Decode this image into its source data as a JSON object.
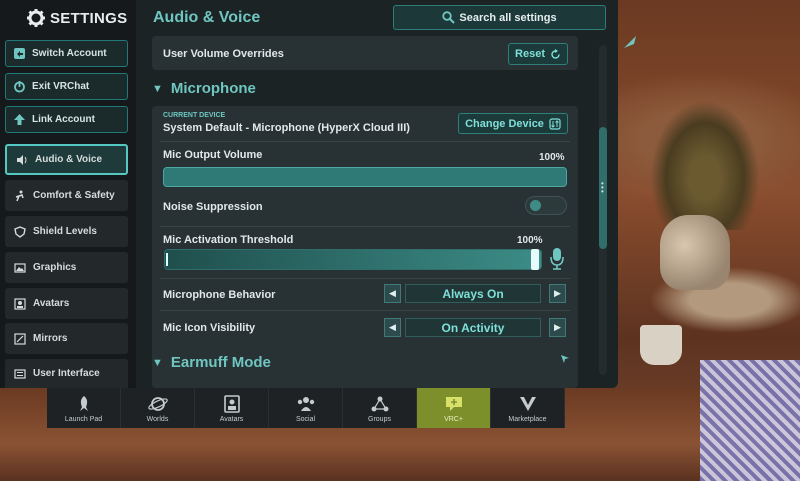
{
  "header": {
    "settings_title": "SETTINGS",
    "panel_title": "Audio & Voice",
    "search_label": "Search all settings"
  },
  "sidebar": {
    "buttons": [
      {
        "label": "Switch Account",
        "icon": "switch-icon"
      },
      {
        "label": "Exit VRChat",
        "icon": "power-icon"
      },
      {
        "label": "Link Account",
        "icon": "arrow-up-icon"
      }
    ],
    "items": [
      {
        "label": "Audio & Voice",
        "icon": "speaker-icon",
        "active": true
      },
      {
        "label": "Comfort & Safety",
        "icon": "person-icon"
      },
      {
        "label": "Shield Levels",
        "icon": "shield-icon"
      },
      {
        "label": "Graphics",
        "icon": "image-icon"
      },
      {
        "label": "Avatars",
        "icon": "avatar-icon"
      },
      {
        "label": "Mirrors",
        "icon": "mirror-icon"
      },
      {
        "label": "User Interface",
        "icon": "keyboard-icon"
      }
    ]
  },
  "main": {
    "volume_overrides": {
      "label": "User Volume Overrides",
      "reset_label": "Reset"
    },
    "microphone": {
      "title": "Microphone",
      "current_device_caption": "CURRENT DEVICE",
      "device_name": "System Default - Microphone (HyperX Cloud III)",
      "change_device_label": "Change Device",
      "output_volume_label": "Mic Output Volume",
      "output_volume_pct": "100%",
      "output_volume_value": 1.0,
      "noise_suppression_label": "Noise Suppression",
      "noise_suppression_on": false,
      "threshold_label": "Mic Activation Threshold",
      "threshold_pct": "100%",
      "threshold_value": 1.0,
      "behavior_label": "Microphone Behavior",
      "behavior_value": "Always On",
      "icon_visibility_label": "Mic Icon Visibility",
      "icon_visibility_value": "On Activity"
    },
    "earmuff": {
      "title": "Earmuff Mode"
    }
  },
  "bottom_nav": [
    {
      "label": "Launch Pad",
      "icon": "rocket-icon"
    },
    {
      "label": "Worlds",
      "icon": "planet-icon"
    },
    {
      "label": "Avatars",
      "icon": "avatars-icon"
    },
    {
      "label": "Social",
      "icon": "social-icon"
    },
    {
      "label": "Groups",
      "icon": "groups-icon"
    },
    {
      "label": "VRC+",
      "icon": "vrc-plus-icon",
      "highlight": true
    },
    {
      "label": "Marketplace",
      "icon": "marketplace-icon"
    }
  ],
  "colors": {
    "accent": "#6fc6c0",
    "panel": "#1c2325",
    "highlight": "#7d8f2a"
  }
}
